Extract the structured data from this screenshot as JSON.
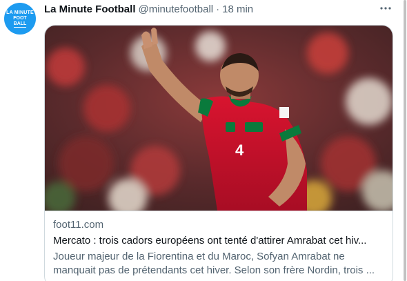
{
  "tweet": {
    "author_name": "La Minute Football",
    "author_handle": "@minutefootball",
    "separator": "·",
    "time": "18 min",
    "more_icon": "more-horizontal-icon",
    "avatar_text": [
      "LA MINUTE",
      "FOOT",
      "BALL"
    ]
  },
  "link_card": {
    "image_subject": "footballer in red Morocco jersey number 4 raising hand",
    "jersey_number": "4",
    "domain": "foot11.com",
    "title": "Mercato : trois cadors européens ont tenté d'attirer Amrabat cet hiv...",
    "description": "Joueur majeur de la Fiorentina et du Maroc, Sofyan Amrabat ne manquait pas de prétendants cet hiver. Selon son frère Nordin, trois ..."
  },
  "colors": {
    "avatar_bg": "#1d9bf0",
    "secondary_text": "#536471",
    "primary_text": "#0f1419",
    "border": "#cfd9de",
    "jersey_red": "#c8102e",
    "jersey_green": "#0a7a3c"
  }
}
